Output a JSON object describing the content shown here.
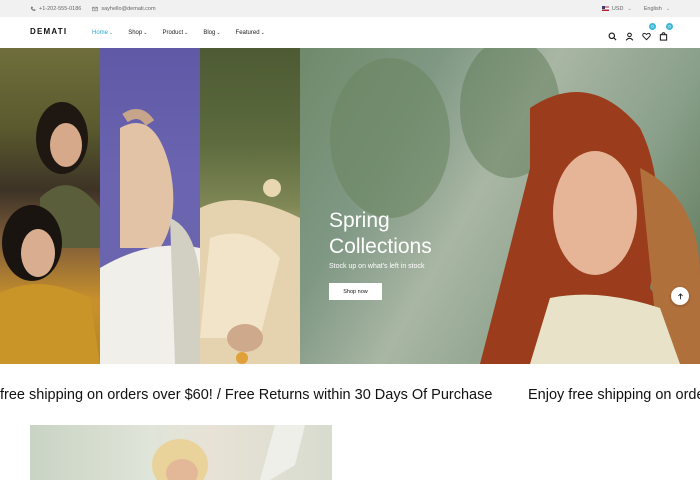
{
  "topbar": {
    "phone": "+1-202-555-0186",
    "email": "sayhello@demati.com",
    "currency": "USD",
    "language": "English"
  },
  "header": {
    "logo": "DEMATI",
    "nav": [
      {
        "label": "Home",
        "active": true
      },
      {
        "label": "Shop",
        "active": false
      },
      {
        "label": "Product",
        "active": false
      },
      {
        "label": "Blog",
        "active": false
      },
      {
        "label": "Featured",
        "active": false
      }
    ],
    "icons": [
      "search-icon",
      "user-icon",
      "heart-icon",
      "bag-icon"
    ],
    "wishlist_count": "0",
    "cart_count": "0"
  },
  "hero": {
    "title_line1": "Spring",
    "title_line2": "Collections",
    "subtitle": "Stock up on what's left in stock",
    "button": "Shop now"
  },
  "marquee": {
    "text1": "free shipping on orders over $60! / Free Returns within 30 Days Of Purchase",
    "text2": "Enjoy free shipping on orde"
  },
  "colors": {
    "accent": "#2aa7c9",
    "badge": "#3bb8d6",
    "topbar_bg": "#f1f1f1",
    "hero_panel2": "#6a65ad"
  }
}
